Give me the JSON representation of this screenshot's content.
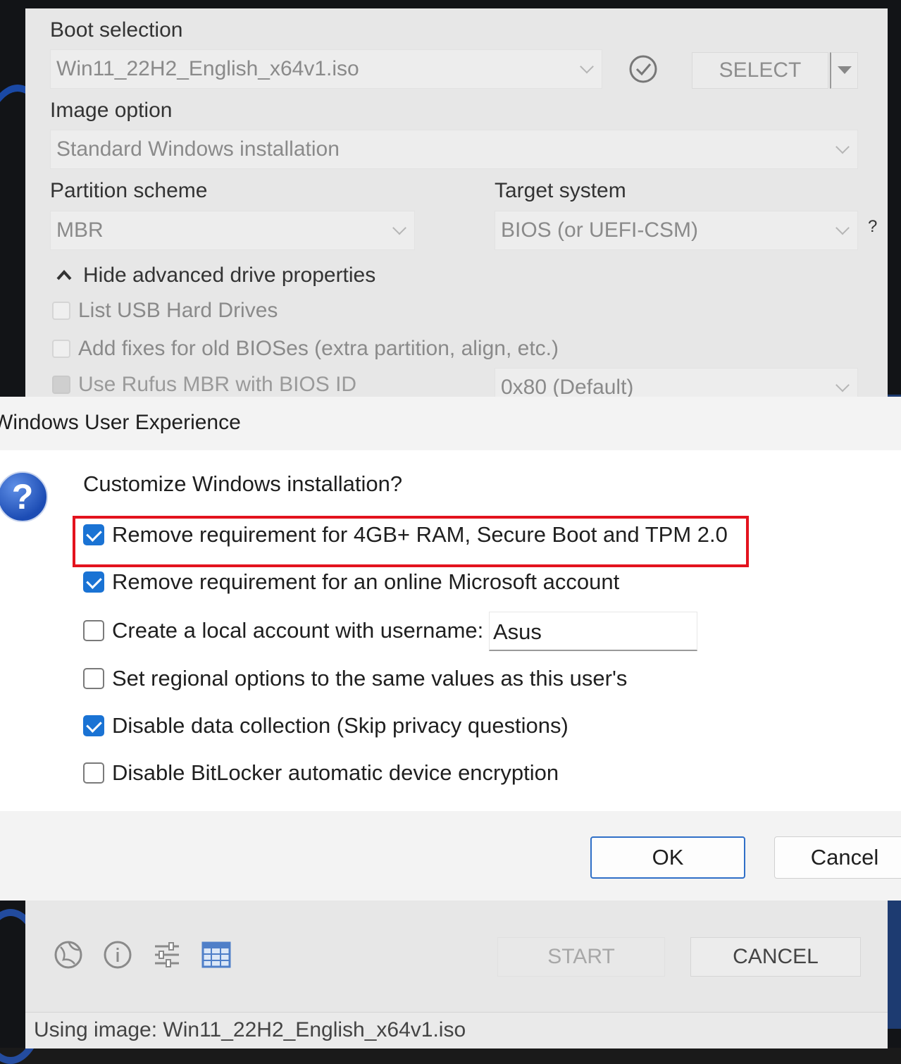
{
  "rufus": {
    "boot_selection_label": "Boot selection",
    "boot_selection_value": "Win11_22H2_English_x64v1.iso",
    "select_button": "SELECT",
    "image_option_label": "Image option",
    "image_option_value": "Standard Windows installation",
    "partition_scheme_label": "Partition scheme",
    "partition_scheme_value": "MBR",
    "target_system_label": "Target system",
    "target_system_value": "BIOS (or UEFI-CSM)",
    "target_help": "?",
    "advanced_toggle": "Hide advanced drive properties",
    "list_usb": "List USB Hard Drives",
    "add_fixes": "Add fixes for old BIOSes (extra partition, align, etc.)",
    "use_rufus_mbr": "Use Rufus MBR with BIOS ID",
    "bios_id_value": "0x80 (Default)",
    "start_button": "START",
    "cancel_button": "CANCEL",
    "status_text": "Using image: Win11_22H2_English_x64v1.iso",
    "toolbar_icons": [
      "globe-icon",
      "info-icon",
      "settings-sliders-icon",
      "log-table-icon"
    ]
  },
  "dialog": {
    "title": "Windows User Experience",
    "question": "Customize Windows installation?",
    "options": [
      {
        "label": "Remove requirement for 4GB+ RAM, Secure Boot and TPM 2.0",
        "checked": true,
        "highlighted": true
      },
      {
        "label": "Remove requirement for an online Microsoft account",
        "checked": true
      },
      {
        "label": "Create a local account with username:",
        "checked": false
      },
      {
        "label": "Set regional options to the same values as this user's",
        "checked": false
      },
      {
        "label": "Disable data collection (Skip privacy questions)",
        "checked": true
      },
      {
        "label": "Disable BitLocker automatic device encryption",
        "checked": false
      }
    ],
    "username_value": "Asus",
    "ok_button": "OK",
    "cancel_button": "Cancel",
    "highlight_color": "#e3131e",
    "accent_color": "#1a73d4"
  }
}
